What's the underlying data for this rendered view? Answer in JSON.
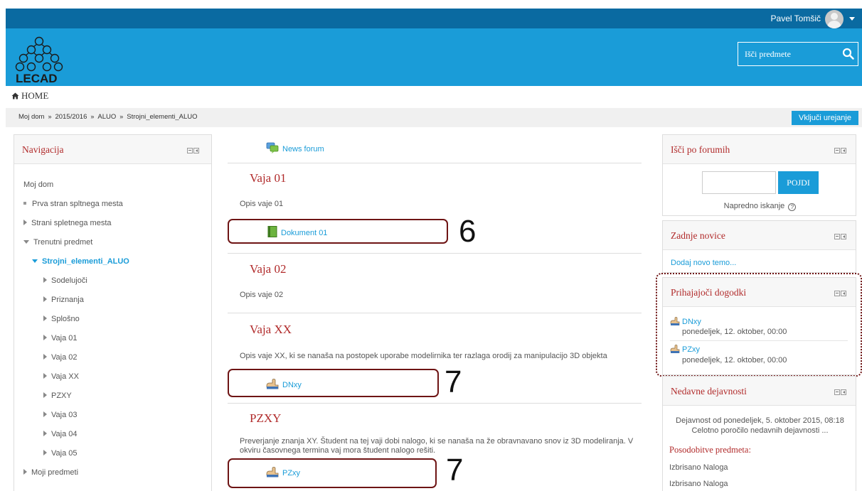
{
  "user": {
    "name": "Pavel Tomšič"
  },
  "logo": {
    "text": "LECAD"
  },
  "search": {
    "placeholder": "Išči predmete"
  },
  "home": {
    "label": "HOME"
  },
  "breadcrumb": [
    "Moj dom",
    "2015/2016",
    "ALUO",
    "Strojni_elementi_ALUO"
  ],
  "breadcrumb_sep": "»",
  "edit_button": "Vključi urejanje",
  "navigation": {
    "title": "Navigacija",
    "items": [
      {
        "label": "Moj dom",
        "marker": "none",
        "indent": 0
      },
      {
        "label": "Prva stran spltnega mesta",
        "marker": "square",
        "indent": 0
      },
      {
        "label": "Strani spletnega mesta",
        "marker": "right",
        "indent": 0
      },
      {
        "label": "Trenutni predmet",
        "marker": "down",
        "indent": 0
      },
      {
        "label": "Strojni_elementi_ALUO",
        "marker": "down",
        "indent": 1,
        "active": true
      },
      {
        "label": "Sodelujoči",
        "marker": "right",
        "indent": 2
      },
      {
        "label": "Priznanja",
        "marker": "right",
        "indent": 2
      },
      {
        "label": "Splošno",
        "marker": "right",
        "indent": 2
      },
      {
        "label": "Vaja 01",
        "marker": "right",
        "indent": 2
      },
      {
        "label": "Vaja 02",
        "marker": "right",
        "indent": 2
      },
      {
        "label": "Vaja XX",
        "marker": "right",
        "indent": 2
      },
      {
        "label": "PZXY",
        "marker": "right",
        "indent": 2
      },
      {
        "label": "Vaja 03",
        "marker": "right",
        "indent": 2
      },
      {
        "label": "Vaja 04",
        "marker": "right",
        "indent": 2
      },
      {
        "label": "Vaja 05",
        "marker": "right",
        "indent": 2
      },
      {
        "label": "Moji predmeti",
        "marker": "right",
        "indent": 0
      }
    ]
  },
  "course": {
    "news_forum": "News forum",
    "sections": [
      {
        "title": "Vaja 01",
        "desc": "Opis vaje 01",
        "activity": "Dokument 01",
        "annotation": "6"
      },
      {
        "title": "Vaja 02",
        "desc": "Opis vaje 02"
      },
      {
        "title": "Vaja XX",
        "desc": "Opis vaje XX, ki se nanaša na postopek uporabe modelirnika ter razlaga orodij za manipulacijo 3D objekta",
        "activity": "DNxy",
        "annotation": "7"
      },
      {
        "title": "PZXY",
        "desc_line1": "Preverjanje znanja XY. Študent na tej vaji dobi nalogo, ki se nanaša na že obravnavano snov iz 3D modeliranja. V",
        "desc_line2": "okviru časovnega termina vaj mora študent nalogo rešiti.",
        "activity": "PZxy",
        "annotation": "7"
      }
    ]
  },
  "forum_search": {
    "title": "Išči po forumih",
    "button": "POJDI",
    "advanced": "Napredno iskanje",
    "help": "?"
  },
  "latest_news": {
    "title": "Zadnje novice",
    "add_link": "Dodaj novo temo..."
  },
  "upcoming": {
    "title": "Prihajajoči dogodki",
    "events": [
      {
        "name": "DNxy",
        "date": "ponedeljek, 12. oktober, 00:00"
      },
      {
        "name": "PZxy",
        "date": "ponedeljek, 12. oktober, 00:00"
      }
    ]
  },
  "recent_activity": {
    "title": "Nedavne dejavnosti",
    "since": "Dejavnost od ponedeljek, 5. oktober 2015, 08:18",
    "full_report": "Celotno poročilo nedavnih dejavnosti ...",
    "updates_title": "Posodobitve predmeta:",
    "updates": [
      "Izbrisano Naloga",
      "Izbrisano Naloga"
    ]
  },
  "colors": {
    "topbar": "#0a6aa1",
    "header": "#1a9cd8",
    "accent": "#1a9cd8",
    "heading": "#b12b2b",
    "annotation": "#6e1414"
  }
}
